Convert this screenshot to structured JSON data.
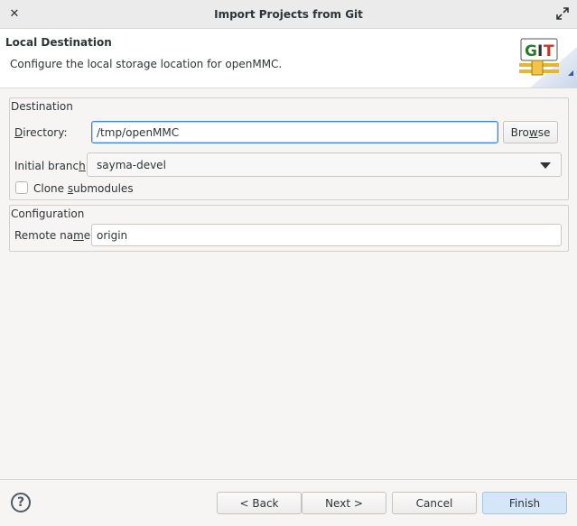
{
  "window": {
    "title": "Import Projects from Git"
  },
  "header": {
    "title": "Local Destination",
    "description": "Configure the local storage location for openMMC.",
    "logo_text": "GIT"
  },
  "destination": {
    "legend": "Destination",
    "directory_label_pre": "",
    "directory_label_ul": "D",
    "directory_label_post": "irectory:",
    "directory_value": "/tmp/openMMC",
    "browse_pre": "Bro",
    "browse_ul": "w",
    "browse_post": "se",
    "branch_label_pre": "Initial branc",
    "branch_label_ul": "h",
    "branch_label_post": ":",
    "branch_value": "sayma-devel",
    "clone_pre": "Clone ",
    "clone_ul": "s",
    "clone_post": "ubmodules",
    "clone_checked": false
  },
  "configuration": {
    "legend": "Configuration",
    "remote_label_pre": "Remote na",
    "remote_label_ul": "m",
    "remote_label_post": "e:",
    "remote_value": "origin"
  },
  "footer": {
    "help_glyph": "?",
    "back_label": "< Back",
    "next_label": "Next >",
    "cancel_label": "Cancel",
    "finish_label": "Finish"
  },
  "colors": {
    "accent": "#3584e4",
    "primary_button": "#d5e6f8"
  }
}
